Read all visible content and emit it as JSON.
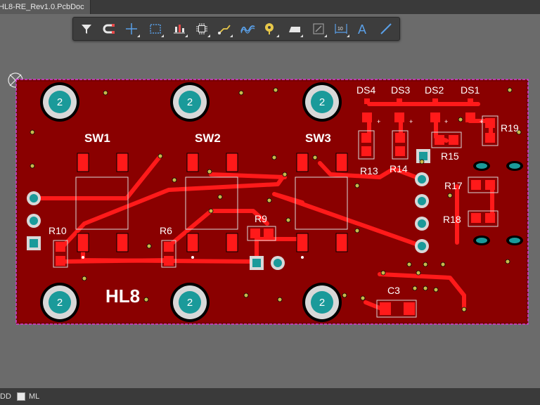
{
  "document_tab": {
    "label": "HL8-RE_Rev1.0.PcbDoc"
  },
  "toolbar": {
    "tools": [
      {
        "icon": "filter-icon"
      },
      {
        "icon": "magnet-route-icon"
      },
      {
        "icon": "crosshair-add-icon"
      },
      {
        "icon": "select-rectangle-icon"
      },
      {
        "icon": "align-icon"
      },
      {
        "icon": "component-icon"
      },
      {
        "icon": "route-track-icon"
      },
      {
        "icon": "diff-pair-icon"
      },
      {
        "icon": "via-pad-icon"
      },
      {
        "icon": "polygon-pour-icon"
      },
      {
        "icon": "keepout-icon"
      },
      {
        "icon": "dimension-icon"
      },
      {
        "icon": "text-string-icon"
      },
      {
        "icon": "line-icon"
      }
    ]
  },
  "board": {
    "mount_hole_label": "2",
    "silk": {
      "switches": [
        "SW1",
        "SW2",
        "SW3"
      ],
      "leds": [
        "DS4",
        "DS3",
        "DS2",
        "DS1"
      ],
      "resistors": {
        "R10": "R10",
        "R6": "R6",
        "R9": "R9",
        "R13": "R13",
        "R14": "R14",
        "R15": "R15",
        "R17": "R17",
        "R18": "R18",
        "R19": "R19"
      },
      "cap": "C3",
      "board_name": "HL8",
      "plus": "+"
    },
    "colors": {
      "copper": "#ff1a1a",
      "board": "#7a0000",
      "outline": "#d63cd6",
      "hole": "#1a9a9a"
    }
  },
  "status": {
    "layer_left": "DD",
    "layer_ml": "ML"
  }
}
